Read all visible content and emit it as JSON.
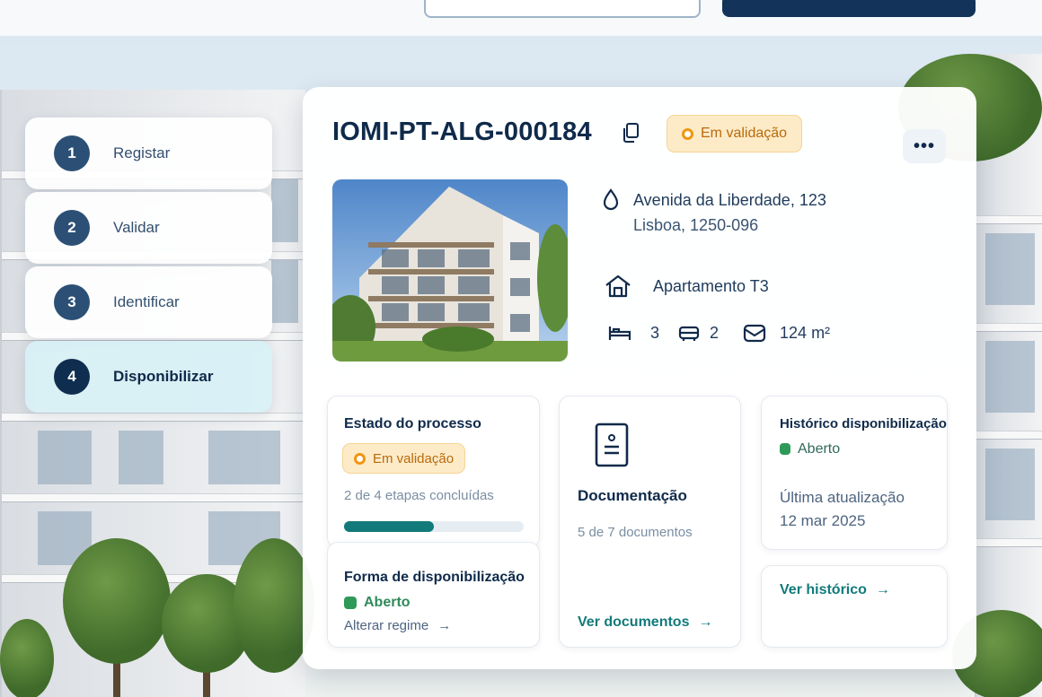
{
  "colors": {
    "accent": "#127a7a",
    "navy": "#0f2a4a",
    "warning": "#f0960f",
    "success": "#2f9a58"
  },
  "steps": [
    {
      "num": "1",
      "label": "Registar"
    },
    {
      "num": "2",
      "label": "Validar"
    },
    {
      "num": "3",
      "label": "Identificar"
    },
    {
      "num": "4",
      "label": "Disponibilizar"
    }
  ],
  "property": {
    "id": "IOMI-PT-ALG-000184",
    "status": "Em validação",
    "address_line1": "Avenida da Liberdade, 123",
    "address_line2": "Lisboa, 1250-096",
    "type": "Apartamento T3",
    "bedrooms": "3",
    "bathrooms": "2",
    "area": "124 m²"
  },
  "process": {
    "title": "Estado do processo",
    "status": "Em validação",
    "steps_done": "2 de 4 etapas concluídas",
    "progress": 0.5
  },
  "availability": {
    "title": "Forma de disponibilização",
    "value": "Aberto",
    "link": "Alterar regime"
  },
  "documents": {
    "title": "Documentação",
    "count": "5 de 7 documentos",
    "link": "Ver documentos"
  },
  "history": {
    "title": "Histórico disponibilização",
    "value": "Aberto",
    "updated_label": "Última atualização",
    "updated_date": "12 mar 2025",
    "link": "Ver histórico"
  },
  "icons": {
    "copy": "copy-icon",
    "more": "more-icon",
    "location": "location-pin-icon",
    "house": "house-icon",
    "bed": "bed-icon",
    "bath": "bath-icon",
    "area": "area-icon",
    "document": "document-icon",
    "arrow": "arrow-right-icon"
  }
}
